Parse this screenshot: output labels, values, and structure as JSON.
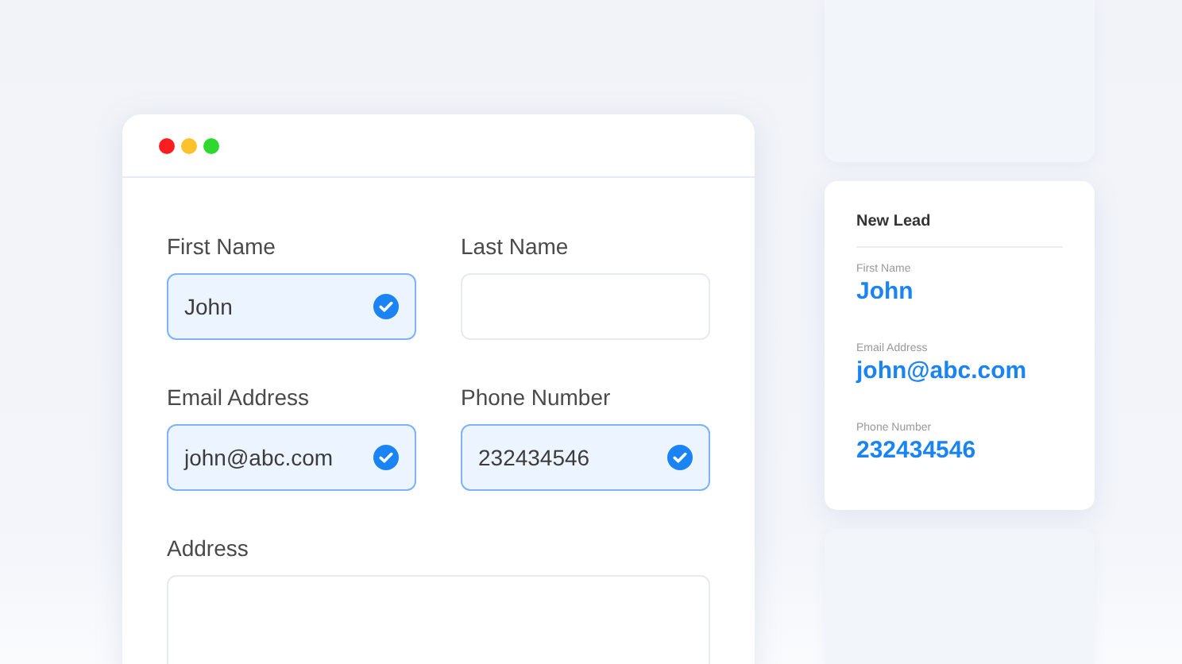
{
  "window": {
    "controls": [
      {
        "color": "#fa1e1e"
      },
      {
        "color": "#fdc22b"
      },
      {
        "color": "#2ed82e"
      }
    ]
  },
  "form": {
    "fields": [
      {
        "kind": "text",
        "label": "First Name",
        "value": "John",
        "verified": true
      },
      {
        "kind": "text",
        "label": "Last Name",
        "verified": false
      },
      {
        "kind": "text",
        "label": "Email Address",
        "value": "john@abc.com",
        "verified": true
      },
      {
        "kind": "text",
        "label": "Phone Number",
        "value": "232434546",
        "verified": true
      },
      {
        "kind": "textarea",
        "label": "Address",
        "verified": false
      }
    ]
  },
  "lead_card": {
    "title": "New Lead",
    "entries": [
      {
        "label": "First Name",
        "value": "John"
      },
      {
        "label": "Email Address",
        "value": "john@abc.com"
      },
      {
        "label": "Phone Number",
        "value": "232434546"
      }
    ]
  }
}
